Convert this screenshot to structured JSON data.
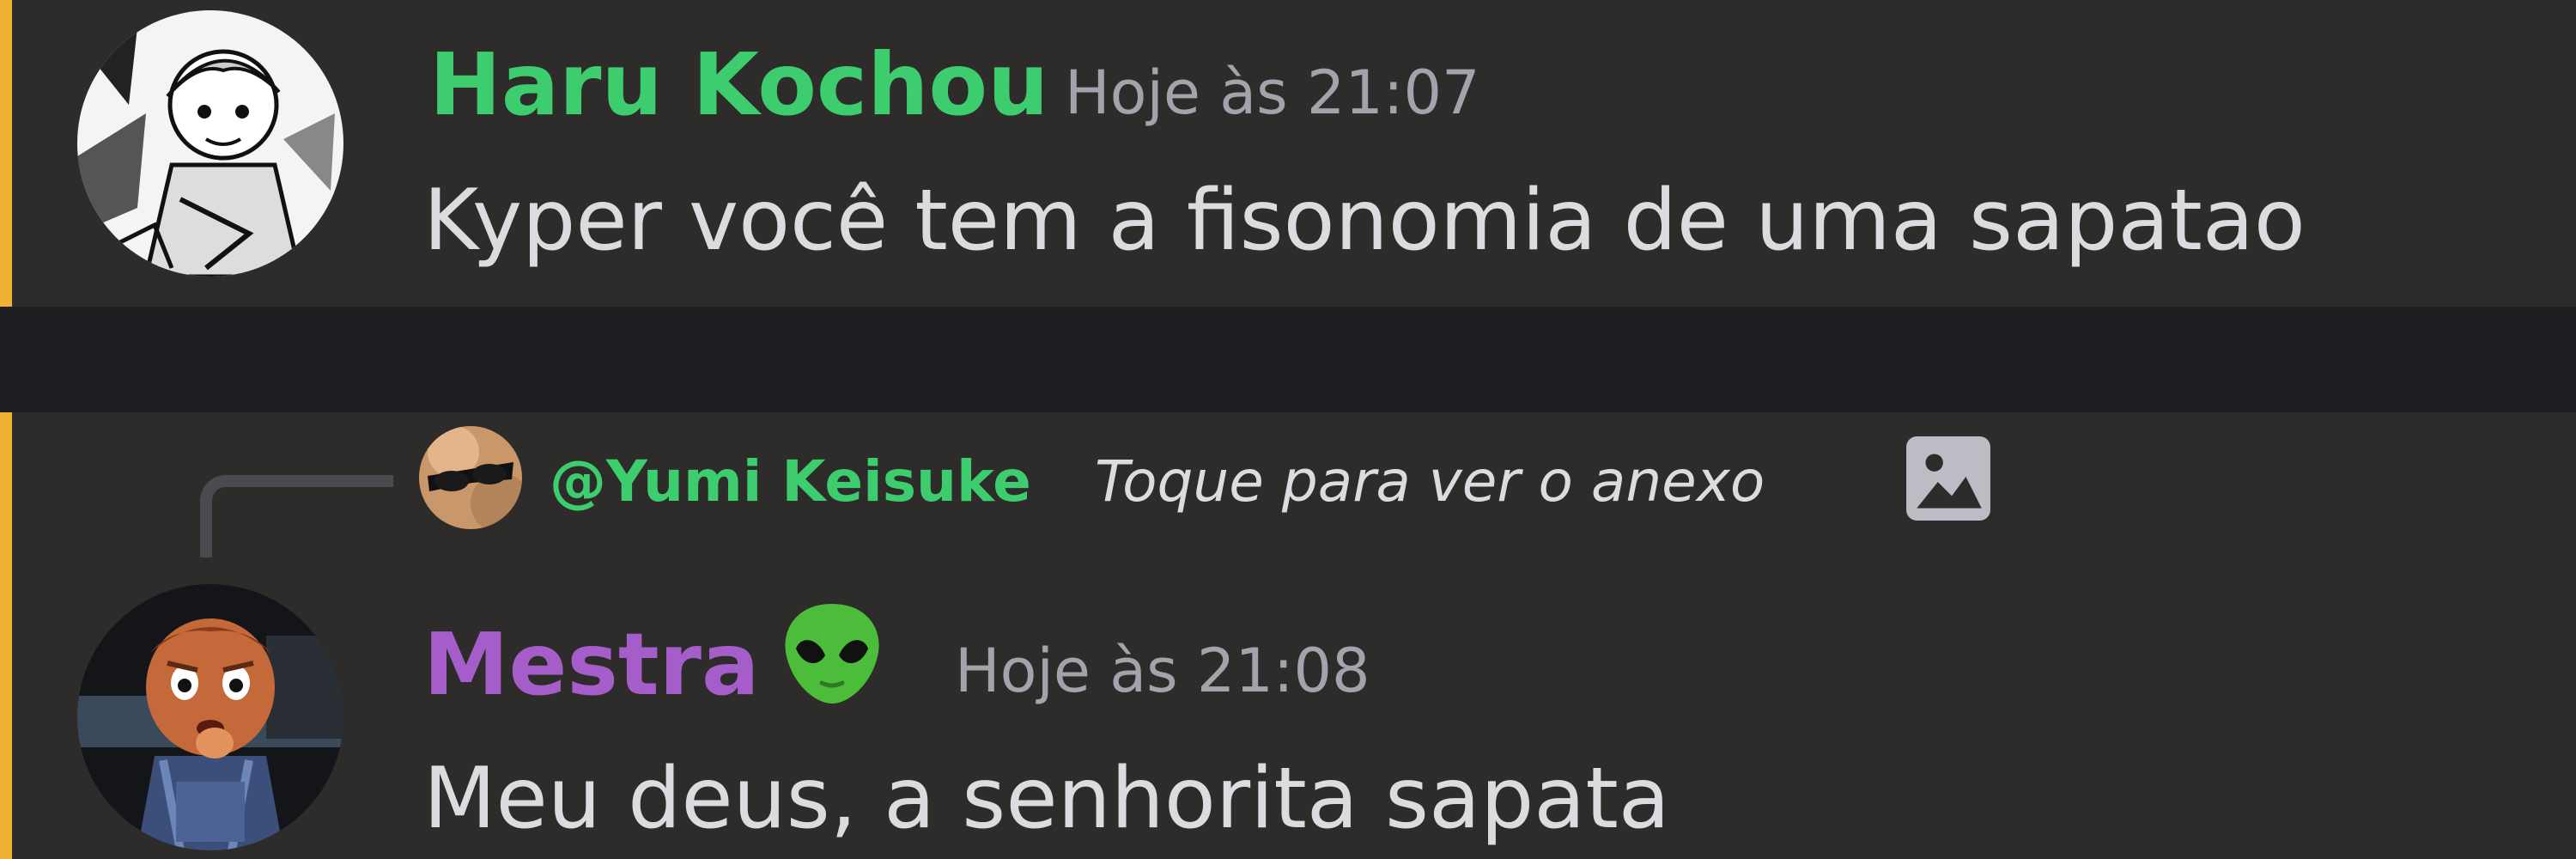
{
  "messages": [
    {
      "author": "Haru Kochou",
      "author_color": "#3dcc6e",
      "timestamp": "Hoje às 21:07",
      "content": "Kyper você tem a fisonomia de uma sapatao",
      "avatar": "manga-avatar"
    },
    {
      "reply": {
        "author": "@Yumi Keisuke",
        "preview": "Toque para ver o anexo",
        "icon": "image-icon"
      },
      "author": "Mestra",
      "author_color": "#a55ec9",
      "author_emoji": "alien-icon",
      "timestamp": "Hoje às 21:08",
      "content": "Meu deus, a senhorita sapata",
      "avatar": "clay-character-avatar"
    }
  ],
  "colors": {
    "background": "#2e2c2b",
    "separator": "#1f1f23",
    "highlight_bar": "#f0b232",
    "text": "#dcdce0",
    "muted": "#a3a3ac"
  }
}
